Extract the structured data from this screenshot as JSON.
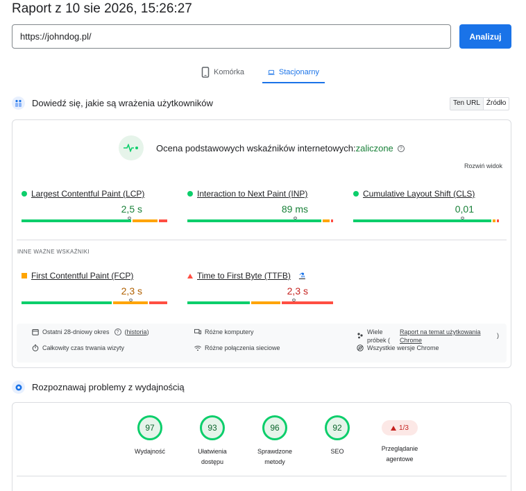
{
  "report": {
    "title": "Raport z 10 sie 2026, 15:26:27"
  },
  "search": {
    "value": "https://johndog.pl/",
    "analyze_label": "Analizuj"
  },
  "device_tabs": [
    {
      "label": "Komórka",
      "icon": "smartphone-icon",
      "active": false
    },
    {
      "label": "Stacjonarny",
      "icon": "laptop-icon",
      "active": true
    }
  ],
  "field": {
    "heading": "Dowiedź się, jakie są wrażenia użytkowników",
    "source_toggle": {
      "url_label": "Ten URL",
      "origin_label": "Źródło"
    },
    "assessment": {
      "text": "Ocena podstawowych wskaźników internetowych:",
      "status": "zaliczone"
    },
    "expand_label": "Rozwiń widok",
    "core_metrics": [
      {
        "name": "Largest Contentful Paint (LCP)",
        "value": "2,5 s"
      },
      {
        "name": "Interaction to Next Paint (INP)",
        "value": "89 ms"
      },
      {
        "name": "Cumulative Layout Shift (CLS)",
        "value": "0,01"
      }
    ],
    "other_label": "INNE WAŻNE WSKAŹNIKI",
    "other_metrics": [
      {
        "name": "First Contentful Paint (FCP)",
        "value": "2,3 s"
      },
      {
        "name": "Time to First Byte (TTFB)",
        "value": "2,3 s"
      }
    ],
    "info": {
      "period": "Ostatni 28-dniowy okres",
      "history_link": "historia",
      "duration": "Całkowity czas trwania wizyty",
      "devices": "Różne komputery",
      "network": "Różne połączenia sieciowe",
      "samples_prefix": "Wiele",
      "samples_suffix": "próbek (",
      "samples_close": ")",
      "crux_link_1": "Raport na temat użytkowania",
      "crux_link_2": "Chrome",
      "chrome_versions": "Wszystkie wersje Chrome"
    }
  },
  "lab": {
    "heading": "Rozpoznawaj problemy z wydajnością",
    "scores": [
      {
        "value": "97",
        "label_1": "Wydajność",
        "label_2": ""
      },
      {
        "value": "93",
        "label_1": "Ułatwienia",
        "label_2": "dostępu"
      },
      {
        "value": "96",
        "label_1": "Sprawdzone",
        "label_2": "metody"
      },
      {
        "value": "92",
        "label_1": "SEO",
        "label_2": ""
      }
    ],
    "agent": {
      "badge": "1/3",
      "label_1": "Przeglądanie",
      "label_2": "agentowe"
    }
  },
  "colors": {
    "good": "#0cce6b",
    "average": "#ffa400",
    "poor": "#ff4e42",
    "accent": "#1a73e8"
  }
}
